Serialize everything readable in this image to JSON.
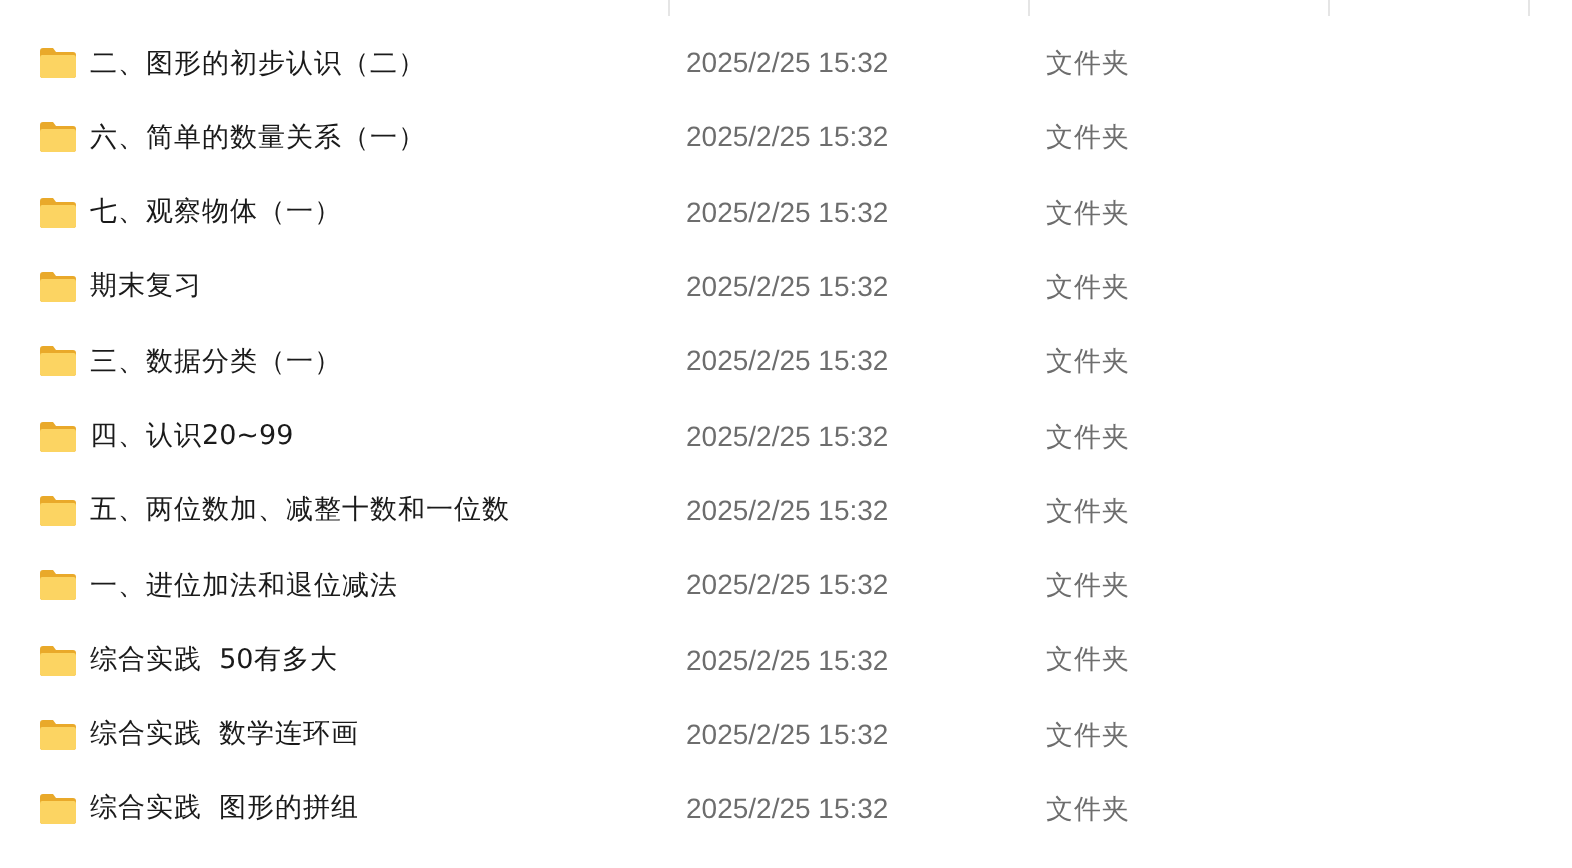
{
  "files": [
    {
      "name": "二、图形的初步认识（二）",
      "modified": "2025/2/25 15:32",
      "type": "文件夹"
    },
    {
      "name": "六、简单的数量关系（一）",
      "modified": "2025/2/25 15:32",
      "type": "文件夹"
    },
    {
      "name": "七、观察物体（一）",
      "modified": "2025/2/25 15:32",
      "type": "文件夹"
    },
    {
      "name": "期末复习",
      "modified": "2025/2/25 15:32",
      "type": "文件夹"
    },
    {
      "name": "三、数据分类（一）",
      "modified": "2025/2/25 15:32",
      "type": "文件夹"
    },
    {
      "name": "四、认识20~99",
      "modified": "2025/2/25 15:32",
      "type": "文件夹"
    },
    {
      "name": "五、两位数加、减整十数和一位数",
      "modified": "2025/2/25 15:32",
      "type": "文件夹"
    },
    {
      "name": "一、进位加法和退位减法",
      "modified": "2025/2/25 15:32",
      "type": "文件夹"
    },
    {
      "name": "综合实践  50有多大",
      "modified": "2025/2/25 15:32",
      "type": "文件夹"
    },
    {
      "name": "综合实践  数学连环画",
      "modified": "2025/2/25 15:32",
      "type": "文件夹"
    },
    {
      "name": "综合实践  图形的拼组",
      "modified": "2025/2/25 15:32",
      "type": "文件夹"
    }
  ]
}
